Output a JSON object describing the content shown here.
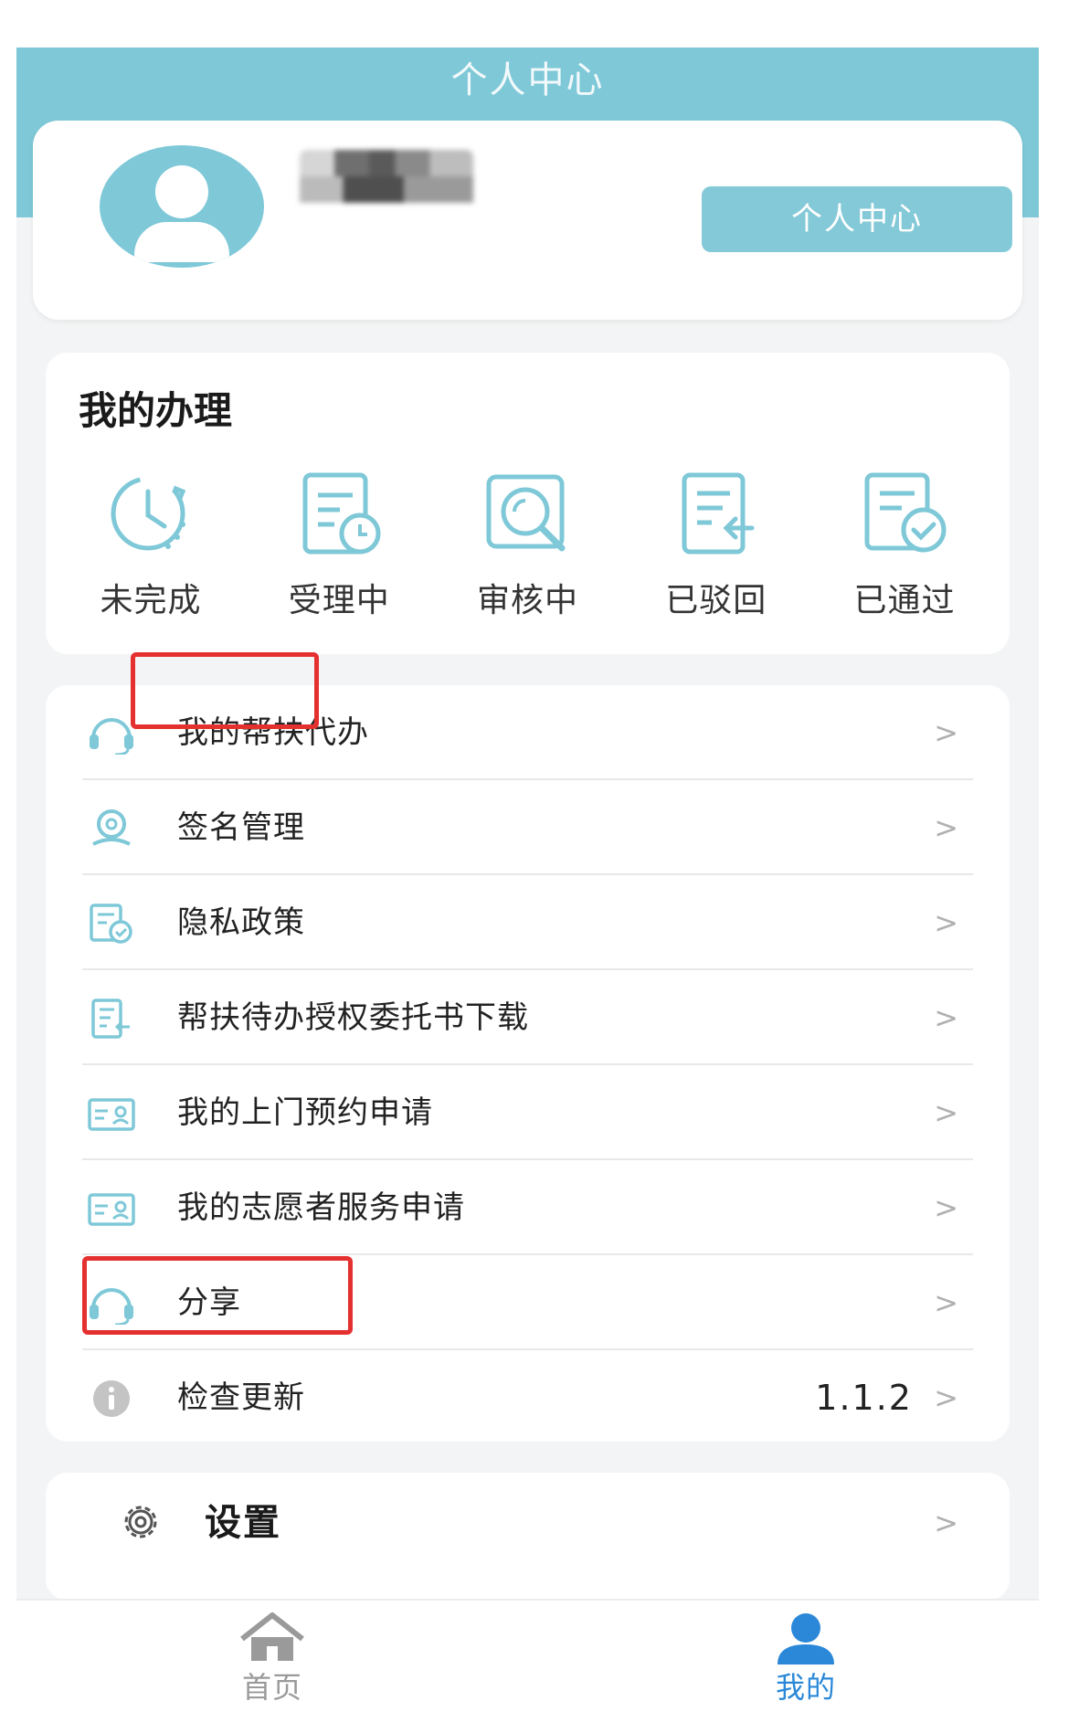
{
  "header": {
    "title": "个人中心"
  },
  "profile": {
    "button_label": "个人中心"
  },
  "handling": {
    "title": "我的办理",
    "statuses": [
      {
        "label": "未完成",
        "icon": "clock-icon"
      },
      {
        "label": "受理中",
        "icon": "document-clock-icon"
      },
      {
        "label": "审核中",
        "icon": "magnifier-review-icon"
      },
      {
        "label": "已驳回",
        "icon": "document-return-icon"
      },
      {
        "label": "已通过",
        "icon": "document-check-icon"
      }
    ]
  },
  "menu": {
    "items": [
      {
        "label": "我的帮扶代办",
        "icon": "headset-icon"
      },
      {
        "label": "签名管理",
        "icon": "signature-pin-icon"
      },
      {
        "label": "隐私政策",
        "icon": "document-check-icon"
      },
      {
        "label": "帮扶待办授权委托书下载",
        "icon": "document-download-icon"
      },
      {
        "label": "我的上门预约申请",
        "icon": "id-card-icon"
      },
      {
        "label": "我的志愿者服务申请",
        "icon": "id-card-icon"
      },
      {
        "label": "分享",
        "icon": "headset-icon"
      },
      {
        "label": "检查更新",
        "icon": "info-icon",
        "value": "1.1.2"
      }
    ],
    "chevron": ">"
  },
  "settings": {
    "label": "设置",
    "icon": "gear-icon"
  },
  "bottom_nav": [
    {
      "label": "首页",
      "icon": "home-icon",
      "active": false
    },
    {
      "label": "我的",
      "icon": "person-icon",
      "active": true
    }
  ],
  "colors": {
    "accent": "#7ec8d8",
    "highlight": "#e53030",
    "active_tab": "#2b88d8",
    "inactive_tab": "#9a9a9a"
  }
}
